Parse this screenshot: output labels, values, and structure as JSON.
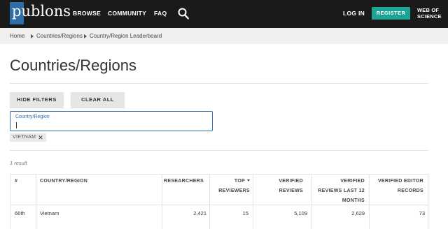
{
  "header": {
    "logo_text": "publons",
    "nav": [
      "BROWSE",
      "COMMUNITY",
      "FAQ"
    ],
    "login": "LOG IN",
    "register": "REGISTER",
    "wos_line1": "WEB OF",
    "wos_line2": "SCIENCE"
  },
  "breadcrumb": [
    "Home",
    "Countries/Regions",
    "Country/Region Leaderboard"
  ],
  "page": {
    "title": "Countries/Regions"
  },
  "filters": {
    "hide_filters": "HIDE FILTERS",
    "clear_all": "CLEAR ALL",
    "field_label": "Country/Region",
    "field_value": "",
    "chip_label": "VIETNAM"
  },
  "results": {
    "count": "1 result"
  },
  "table": {
    "columns": {
      "rank": "#",
      "country": "COUNTRY/REGION",
      "researchers": "RESEARCHERS",
      "top_reviewers_1": "TOP",
      "top_reviewers_2": "REVIEWERS",
      "verified_reviews_1": "VERIFIED",
      "verified_reviews_2": "REVIEWS",
      "last12_1": "VERIFIED",
      "last12_2": "REVIEWS LAST 12",
      "last12_3": "MONTHS",
      "editor_1": "VERIFIED EDITOR",
      "editor_2": "RECORDS"
    },
    "rows": [
      {
        "rank": "66th",
        "country": "Vietnam",
        "researchers": "2,421",
        "top_reviewers": "15",
        "verified_reviews": "5,109",
        "last12": "2,629",
        "editor_records": "73"
      }
    ]
  },
  "colors": {
    "nav_bg": "#1a1a1a",
    "brand_blue": "#2e6fa8",
    "register_green": "#1ca394",
    "crumb_bg": "#f0f0f0"
  }
}
